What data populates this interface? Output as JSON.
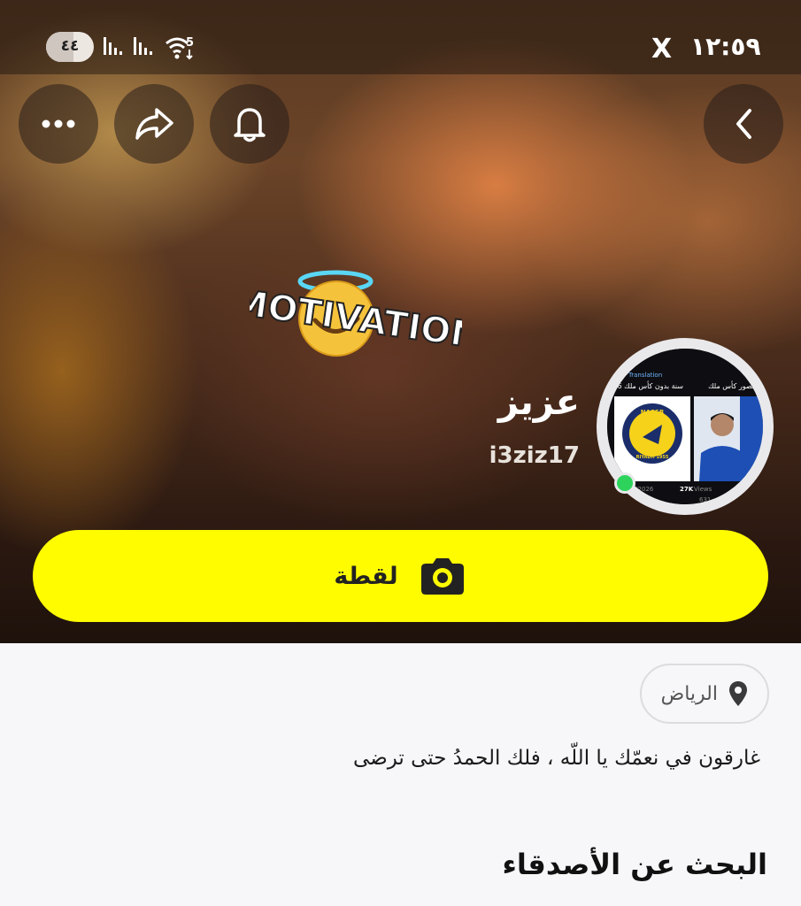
{
  "status_bar": {
    "time": "١٢:٥٩",
    "battery": "٤٤",
    "x_app_icon": "X",
    "wifi_badge": "5"
  },
  "header": {
    "back_icon": "chevron-left-icon",
    "bell_icon": "bell-icon",
    "share_icon": "share-icon",
    "more_icon": "more-horizontal-icon"
  },
  "sticker": {
    "text": "MOTIVATION"
  },
  "profile": {
    "display_name": "عزيز",
    "username": "i3ziz17",
    "avatar": {
      "tweet_title_right": "36 سنة بدون كأس ملك",
      "tweet_title_left": "نصور كأس ملك",
      "translation_label": "Translation",
      "club_badge": {
        "top": "NASSR",
        "bottom": "RIYADH 1955"
      },
      "date": "08/05/2026",
      "views": "27K",
      "views_label": "Views",
      "likes": "631"
    }
  },
  "snap_button": {
    "label": "لقطة",
    "icon": "camera-icon"
  },
  "location": {
    "label": "الرياض",
    "icon": "location-pin-icon"
  },
  "bio": "غارقون في نعمّك يا اللّه ، فلك الحمدُ حتى ترضى",
  "sections": {
    "find_friends": "البحث عن الأصدقاء"
  },
  "colors": {
    "snap_yellow": "#fffc00",
    "online_green": "#2ed35b"
  }
}
